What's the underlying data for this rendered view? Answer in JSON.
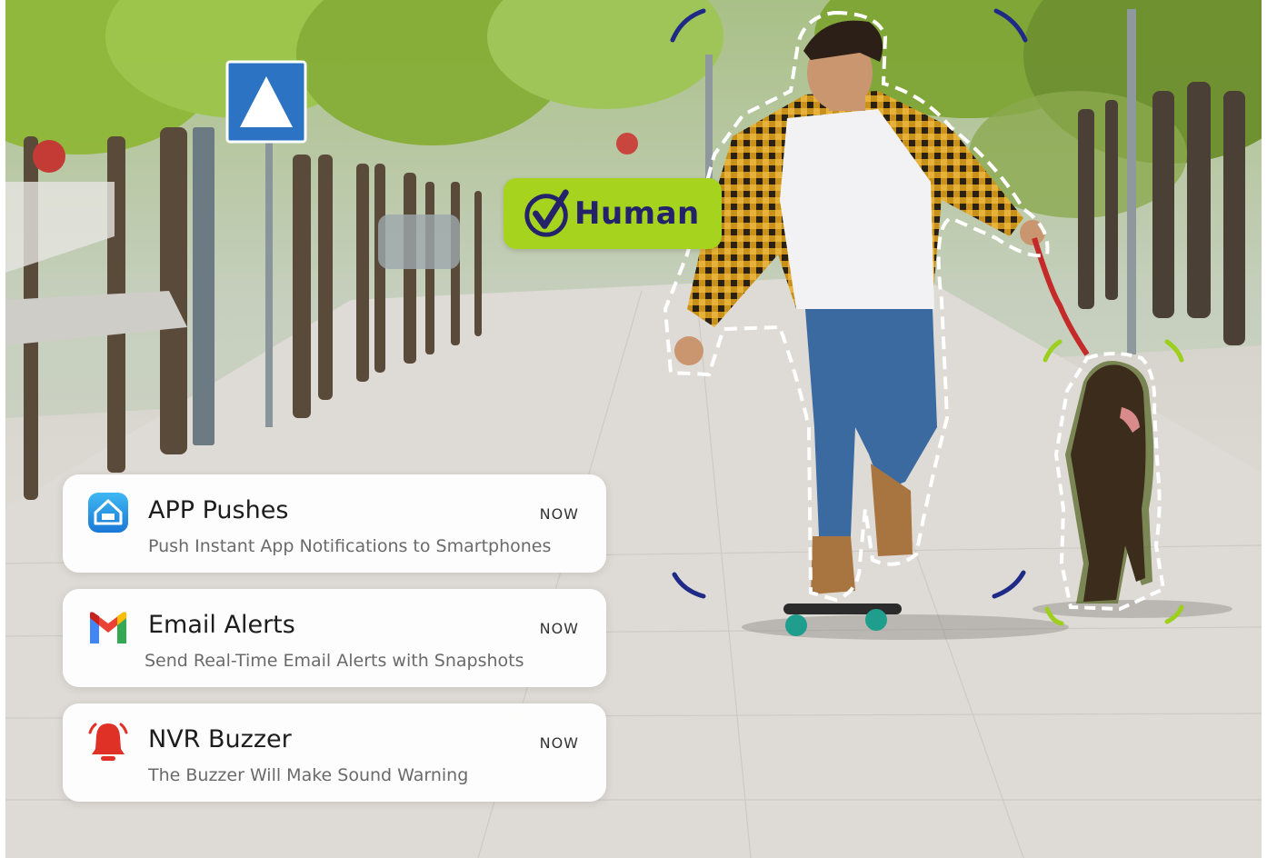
{
  "badge": {
    "label": "Human"
  },
  "notifications": [
    {
      "icon": "home-app-icon",
      "title": "APP Pushes",
      "time": "NOW",
      "description": "Push Instant App Notifications to Smartphones"
    },
    {
      "icon": "gmail-icon",
      "title": "Email Alerts",
      "time": "NOW",
      "description": "Send Real-Time Email Alerts with Snapshots"
    },
    {
      "icon": "bell-icon",
      "title": "NVR Buzzer",
      "time": "NOW",
      "description": "The Buzzer Will Make Sound Warning"
    }
  ],
  "colors": {
    "accent_green": "#a6d41e",
    "badge_text": "#23226a",
    "frame_navy": "#1f2a86",
    "dog_frame": "#9ccf1e"
  }
}
